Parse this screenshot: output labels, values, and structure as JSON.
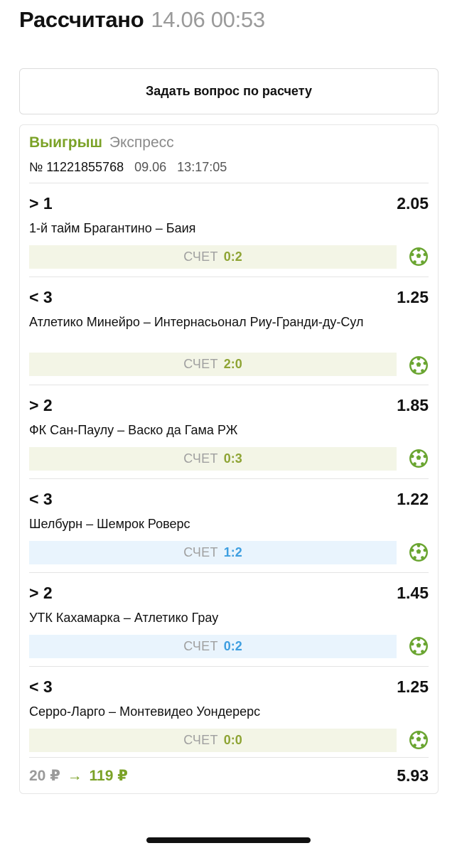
{
  "header": {
    "title": "Рассчитано",
    "datetime": "14.06 00:53"
  },
  "ask_button": {
    "label": "Задать вопрос по расчету"
  },
  "bet": {
    "status": "Выигрыш",
    "type": "Экспресс",
    "number": "№ 11221855768",
    "date": "09.06",
    "time": "13:17:05",
    "events": [
      {
        "bet": "> 1",
        "odds": "2.05",
        "match": "1-й тайм Брагантино – Баия",
        "score_label": "СЧЕТ",
        "score": "0:2",
        "score_style": "green",
        "icon": "soccer-ball-icon"
      },
      {
        "bet": "< 3",
        "odds": "1.25",
        "match": "Атлетико Минейро – Интернасьонал Риу-Гранди-ду-Сул",
        "score_label": "СЧЕТ",
        "score": "2:0",
        "score_style": "green",
        "icon": "soccer-ball-icon"
      },
      {
        "bet": "> 2",
        "odds": "1.85",
        "match": "ФК Сан-Паулу – Васко да Гама РЖ",
        "score_label": "СЧЕТ",
        "score": "0:3",
        "score_style": "green",
        "icon": "soccer-ball-icon"
      },
      {
        "bet": "< 3",
        "odds": "1.22",
        "match": "Шелбурн – Шемрок Роверс",
        "score_label": "СЧЕТ",
        "score": "1:2",
        "score_style": "blue",
        "icon": "soccer-ball-icon"
      },
      {
        "bet": "> 2",
        "odds": "1.45",
        "match": "УТК Кахамарка – Атлетико Грау",
        "score_label": "СЧЕТ",
        "score": "0:2",
        "score_style": "blue",
        "icon": "soccer-ball-icon"
      },
      {
        "bet": "< 3",
        "odds": "1.25",
        "match": "Серро-Ларго – Монтевидео Уондерерс",
        "score_label": "СЧЕТ",
        "score": "0:0",
        "score_style": "green",
        "icon": "soccer-ball-icon"
      }
    ],
    "stake": "20 ₽",
    "arrow": "→",
    "payout": "119 ₽",
    "total_odds": "5.93"
  },
  "colors": {
    "win_green": "#7ba227",
    "score_green_text": "#8ea434",
    "score_green_bg": "#f3f5e6",
    "score_blue_text": "#3d9ee0",
    "score_blue_bg": "#e9f4fd",
    "ball_green": "#6aa531"
  }
}
